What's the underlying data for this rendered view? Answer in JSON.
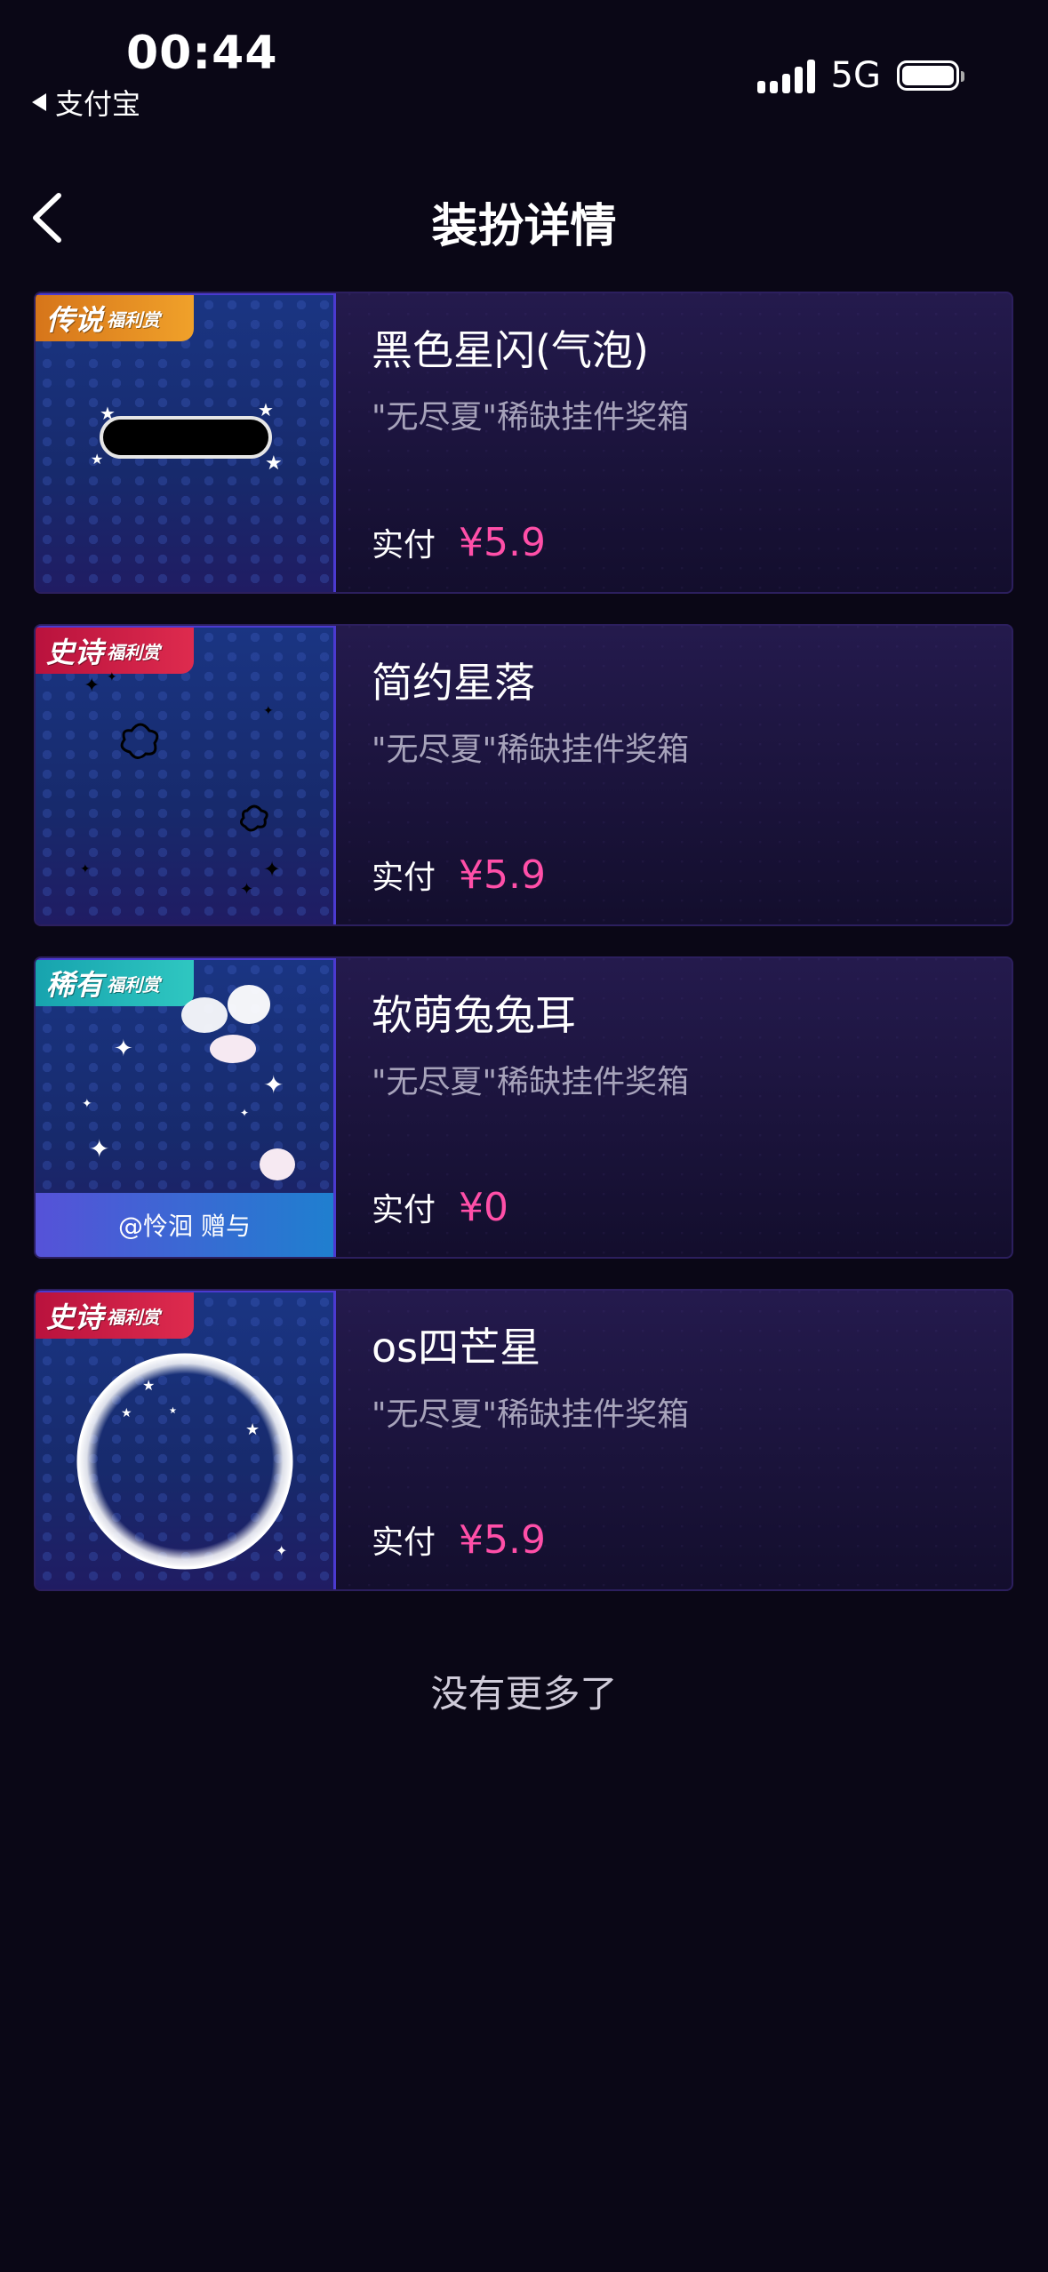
{
  "status": {
    "time": "00:44",
    "back_app": "支付宝",
    "network": "5G"
  },
  "nav": {
    "title": "装扮详情"
  },
  "items": [
    {
      "name": "黑色星闪(气泡)",
      "source": "\"无尽夏\"稀缺挂件奖箱",
      "price_label": "实付",
      "price": "¥5.9",
      "badge_big": "传说",
      "badge_small": "福利赏"
    },
    {
      "name": "简约星落",
      "source": "\"无尽夏\"稀缺挂件奖箱",
      "price_label": "实付",
      "price": "¥5.9",
      "badge_big": "史诗",
      "badge_small": "福利赏"
    },
    {
      "name": "软萌兔兔耳",
      "source": "\"无尽夏\"稀缺挂件奖箱",
      "price_label": "实付",
      "price": "¥0",
      "badge_big": "稀有",
      "badge_small": "福利赏",
      "gift_note": "@怜洄 赠与"
    },
    {
      "name": "os四芒星",
      "source": "\"无尽夏\"稀缺挂件奖箱",
      "price_label": "实付",
      "price": "¥5.9",
      "badge_big": "史诗",
      "badge_small": "福利赏"
    }
  ],
  "footer": {
    "text": "没有更多了"
  },
  "colors": {
    "background": "#0a0716",
    "price": "#ff4fa8",
    "legend_badge": "#e58a22",
    "epic_badge": "#cc1d45",
    "rare_badge": "#22b5b8"
  }
}
